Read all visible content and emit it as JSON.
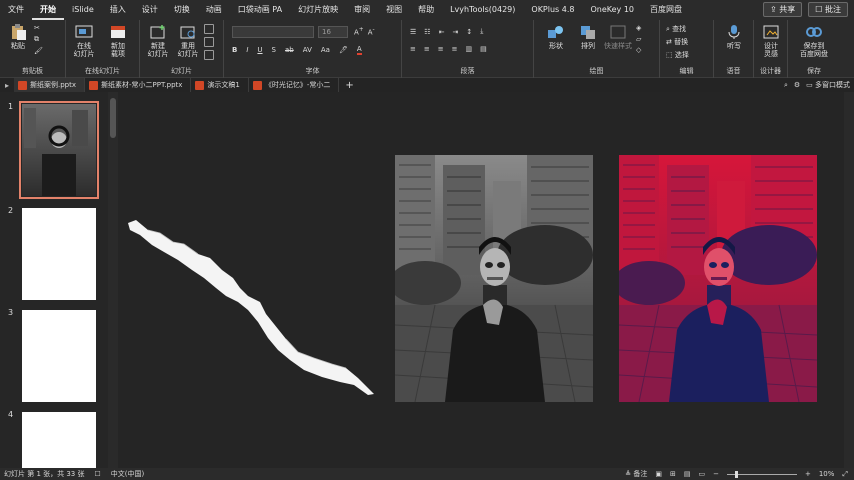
{
  "menu": {
    "items": [
      "文件",
      "开始",
      "iSlide",
      "插入",
      "设计",
      "切换",
      "动画",
      "口袋动画 PA",
      "幻灯片放映",
      "审阅",
      "视图",
      "帮助",
      "LvyhTools(0429)",
      "OKPlus 4.8",
      "OneKey 10",
      "百度网盘"
    ],
    "active": "开始",
    "share": "共享",
    "comments": "批注"
  },
  "ribbon": {
    "clipboard": {
      "paste": "粘贴",
      "label": "剪贴板"
    },
    "online": {
      "btn1_l1": "在线",
      "btn1_l2": "幻灯片",
      "btn2_l1": "新加",
      "btn2_l2": "载项",
      "label": "在线幻灯片"
    },
    "slides": {
      "new_l1": "新建",
      "new_l2": "幻灯片",
      "reuse_l1": "重用",
      "reuse_l2": "幻灯片",
      "label": "幻灯片"
    },
    "font": {
      "size": "16",
      "label": "字体"
    },
    "paragraph": {
      "label": "段落"
    },
    "drawing": {
      "shape": "形状",
      "arrange": "排列",
      "quick_style": "快速样式",
      "label": "绘图"
    },
    "editing": {
      "find": "查找",
      "replace": "替换",
      "select": "选择",
      "label": "编辑"
    },
    "voice": {
      "dictate": "听写",
      "label": "语音"
    },
    "designer": {
      "btn_l1": "设计",
      "btn_l2": "灵感",
      "label": "设计器"
    },
    "save": {
      "btn_l1": "保存到",
      "btn_l2": "百度网盘",
      "label": "保存"
    }
  },
  "tabs": [
    {
      "label": "撕纸案例.pptx",
      "active": true
    },
    {
      "label": "撕纸素材-常小二PPT.pptx",
      "active": false
    },
    {
      "label": "演示文稿1",
      "active": false
    },
    {
      "label": "《时光记忆》-常小二",
      "active": false
    }
  ],
  "tab_right": {
    "window_label": "多窗口模式"
  },
  "thumbnails": [
    {
      "num": "1",
      "selected": true
    },
    {
      "num": "2",
      "selected": false
    },
    {
      "num": "3",
      "selected": false
    },
    {
      "num": "4",
      "selected": false
    }
  ],
  "status": {
    "slide_info": "幻灯片 第 1 张，共 33 张",
    "language": "中文(中国)",
    "notes": "备注",
    "zoom": "10%"
  },
  "colors": {
    "accent_selection": "#e3826a",
    "duotone_red": "#c8102e",
    "duotone_blue": "#1b1f5e"
  }
}
